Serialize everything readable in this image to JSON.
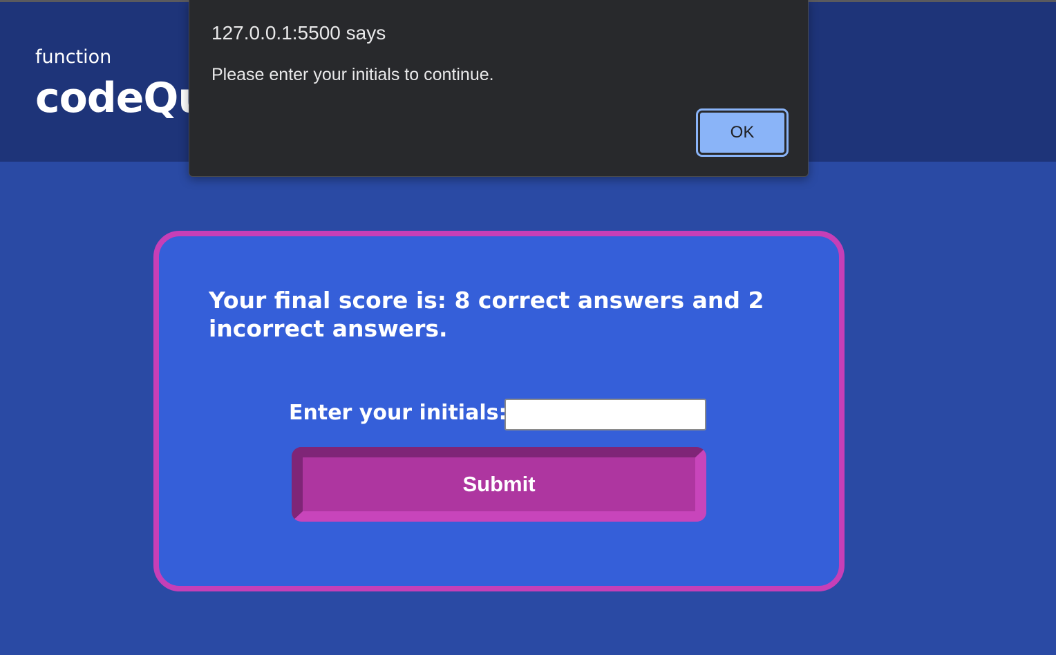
{
  "header": {
    "brand_small": "function",
    "brand_big": "codeQu"
  },
  "quiz_result": {
    "score_text": "Your final score is: 8 correct answers and 2 incorrect answers.",
    "initials_label": "Enter your initials:",
    "initials_value": "",
    "submit_label": "Submit"
  },
  "alert_dialog": {
    "title": "127.0.0.1:5500 says",
    "message": "Please enter your initials to continue.",
    "ok_label": "OK"
  },
  "colors": {
    "header_bg": "#1e3479",
    "page_bg": "#2a4aa4",
    "card_bg": "#355fd9",
    "card_border": "#c63fb7",
    "button_bg": "#ae36a0",
    "dialog_bg": "#28292c",
    "dialog_button": "#8ab4f8"
  }
}
